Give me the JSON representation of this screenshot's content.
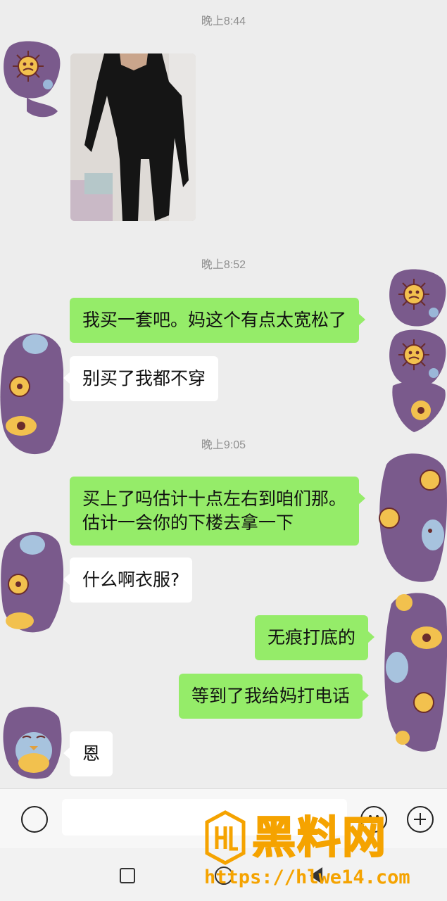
{
  "messages": [
    {
      "type": "timestamp",
      "text": "晚上8:44"
    },
    {
      "type": "image",
      "sender": "contact"
    },
    {
      "type": "timestamp",
      "text": "晚上8:52"
    },
    {
      "type": "text",
      "sender": "me",
      "text": "我买一套吧。妈这个有点太宽松了"
    },
    {
      "type": "text",
      "sender": "contact",
      "text": "别买了我都不穿"
    },
    {
      "type": "timestamp",
      "text": "晚上9:05"
    },
    {
      "type": "text",
      "sender": "me",
      "lines": [
        "买上了吗估计十点左右到咱们那。",
        "估计一会你的下楼去拿一下"
      ]
    },
    {
      "type": "text",
      "sender": "contact",
      "text": "什么啊衣服?"
    },
    {
      "type": "text",
      "sender": "me",
      "text": "无痕打底的"
    },
    {
      "type": "text",
      "sender": "me",
      "text": "等到了我给妈打电话"
    },
    {
      "type": "text",
      "sender": "contact",
      "text": "恩"
    }
  ],
  "input_bar": {
    "icons": [
      "voice-icon",
      "emoji-icon",
      "plus-icon"
    ]
  },
  "nav_bar": {
    "icons": [
      "recent-apps-icon",
      "home-icon",
      "back-icon"
    ]
  },
  "watermark": {
    "title": "黑料网",
    "url": "https://hlwe14.com"
  },
  "colors": {
    "background": "#ededed",
    "outgoing_bubble": "#95ec69",
    "incoming_bubble": "#ffffff",
    "timestamp": "#8e8e8e",
    "avatar_purple": "#7a5a8c",
    "watermark": "#f5a300"
  }
}
